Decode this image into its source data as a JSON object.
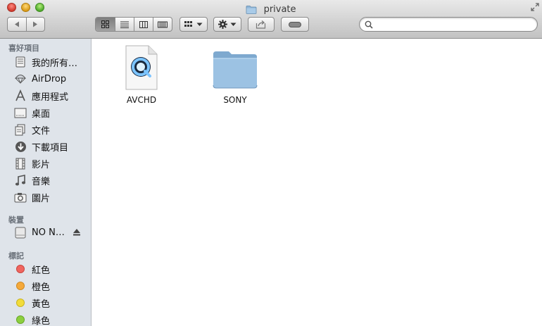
{
  "window": {
    "title": "private"
  },
  "toolbar": {
    "search_placeholder": "",
    "search_value": ""
  },
  "sidebar": {
    "favorites_header": "喜好項目",
    "favorites": [
      {
        "label": "我的所有…",
        "icon": "all-my-files-icon"
      },
      {
        "label": "AirDrop",
        "icon": "airdrop-icon"
      },
      {
        "label": "應用程式",
        "icon": "applications-icon"
      },
      {
        "label": "桌面",
        "icon": "desktop-icon"
      },
      {
        "label": "文件",
        "icon": "documents-icon"
      },
      {
        "label": "下載項目",
        "icon": "downloads-icon"
      },
      {
        "label": "影片",
        "icon": "movies-icon"
      },
      {
        "label": "音樂",
        "icon": "music-icon"
      },
      {
        "label": "圖片",
        "icon": "pictures-icon"
      }
    ],
    "devices_header": "裝置",
    "devices": [
      {
        "label": "NO N…",
        "icon": "drive-icon"
      }
    ],
    "tags_header": "標記",
    "tags": [
      {
        "label": "紅色",
        "color": "#f0655f"
      },
      {
        "label": "橙色",
        "color": "#f5a93a"
      },
      {
        "label": "黃色",
        "color": "#f2dc3b"
      },
      {
        "label": "綠色",
        "color": "#8ccf3f"
      }
    ]
  },
  "files": [
    {
      "name": "AVCHD",
      "icon": "quicktime-document-icon"
    },
    {
      "name": "SONY",
      "icon": "folder-icon"
    }
  ]
}
